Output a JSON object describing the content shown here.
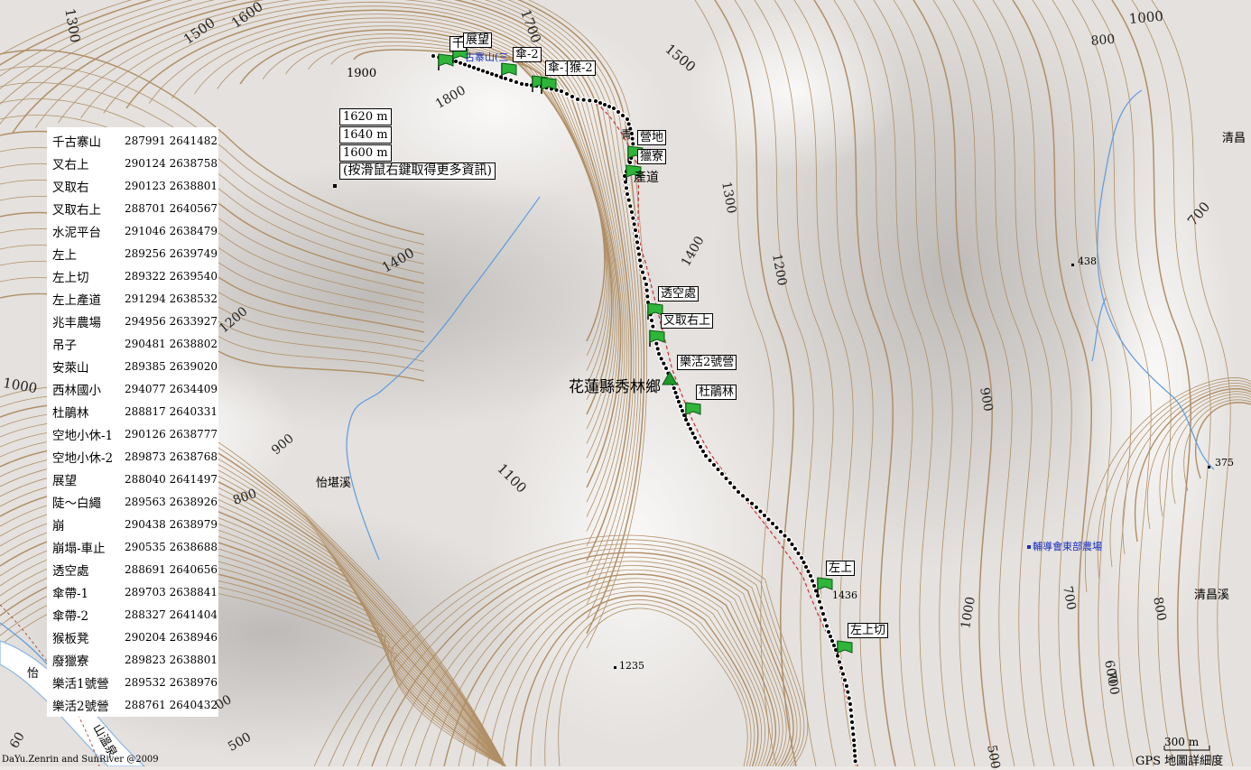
{
  "tooltip": {
    "lines": [
      "1620 m",
      "1640 m",
      "1600 m"
    ],
    "hint": "(按滑鼠右鍵取得更多資訊)"
  },
  "waypoints": [
    {
      "name": "千古寨山",
      "coord": "287991 2641482"
    },
    {
      "name": "叉右上",
      "coord": "290124 2638758"
    },
    {
      "name": "叉取右",
      "coord": "290123 2638801"
    },
    {
      "name": "叉取右上",
      "coord": "288701 2640567"
    },
    {
      "name": "水泥平台",
      "coord": "291046 2638479"
    },
    {
      "name": "左上",
      "coord": "289256 2639749"
    },
    {
      "name": "左上切",
      "coord": "289322 2639540"
    },
    {
      "name": "左上產道",
      "coord": "291294 2638532"
    },
    {
      "name": "兆丰農場",
      "coord": "294956 2633927"
    },
    {
      "name": "吊子",
      "coord": "290481 2638802"
    },
    {
      "name": "安萊山",
      "coord": "289385 2639020"
    },
    {
      "name": "西林國小",
      "coord": "294077 2634409"
    },
    {
      "name": "杜鵑林",
      "coord": "288817 2640331"
    },
    {
      "name": "空地小休-1",
      "coord": "290126 2638777"
    },
    {
      "name": "空地小休-2",
      "coord": "289873 2638768"
    },
    {
      "name": "展望",
      "coord": "288040 2641497"
    },
    {
      "name": "陡～白繩",
      "coord": "289563 2638926"
    },
    {
      "name": "崩",
      "coord": "290438 2638979"
    },
    {
      "name": "崩塌-車止",
      "coord": "290535 2638688"
    },
    {
      "name": "透空處",
      "coord": "288691 2640656"
    },
    {
      "name": "傘帶-1",
      "coord": "289703 2638841"
    },
    {
      "name": "傘帶-2",
      "coord": "288327 2641404"
    },
    {
      "name": "猴板凳",
      "coord": "290204 2638946"
    },
    {
      "name": "廢獵寮",
      "coord": "289823 2638801"
    },
    {
      "name": "樂活1號營",
      "coord": "289532 2638976"
    },
    {
      "name": "樂活2號營",
      "coord": "288761 2640432"
    }
  ],
  "map_labels": {
    "district": "花蓮縣秀林鄉",
    "stream_yikan": "怡堪溪",
    "stream_qingchang": "清昌溪",
    "stream_qingchang_top": "清昌",
    "farm": "輔導會東部農場",
    "stream_left": "怡",
    "road_left": "山溫泉",
    "spot_1235": "1235",
    "spot_1436": "1436",
    "spot_438": "438",
    "spot_375": "375",
    "spot_1900": "1900"
  },
  "contour_labels": [
    "1300",
    "1500",
    "1600",
    "1700",
    "1800",
    "1500",
    "1000",
    "800",
    "1400",
    "1300",
    "1200",
    "700",
    "1200",
    "1400",
    "1000",
    "900",
    "800",
    "1100",
    "500",
    "700",
    "1000",
    "600",
    "900",
    "800",
    "500",
    "00",
    "60",
    "700"
  ],
  "track_labels": {
    "zhanwang": "展望",
    "qian": "千",
    "top_blue": "古寨山(三",
    "san2": "傘-2",
    "san1": "傘-1",
    "hou2": "猴-2",
    "ying_di": "營地",
    "liao": "獵寮",
    "chan_dao": "產道",
    "qing": "青",
    "toukong": "透空處",
    "chaquyoushang": "叉取右上",
    "camp2": "樂活2號營",
    "dujuanlin": "杜鵑林",
    "zuoshang": "左上",
    "zuoshangqie": "左上切"
  },
  "scale": "300 m",
  "footer_left": "DaYu.Zenrin and SunRiver @2009",
  "footer_right": "GPS 地圖詳細度"
}
